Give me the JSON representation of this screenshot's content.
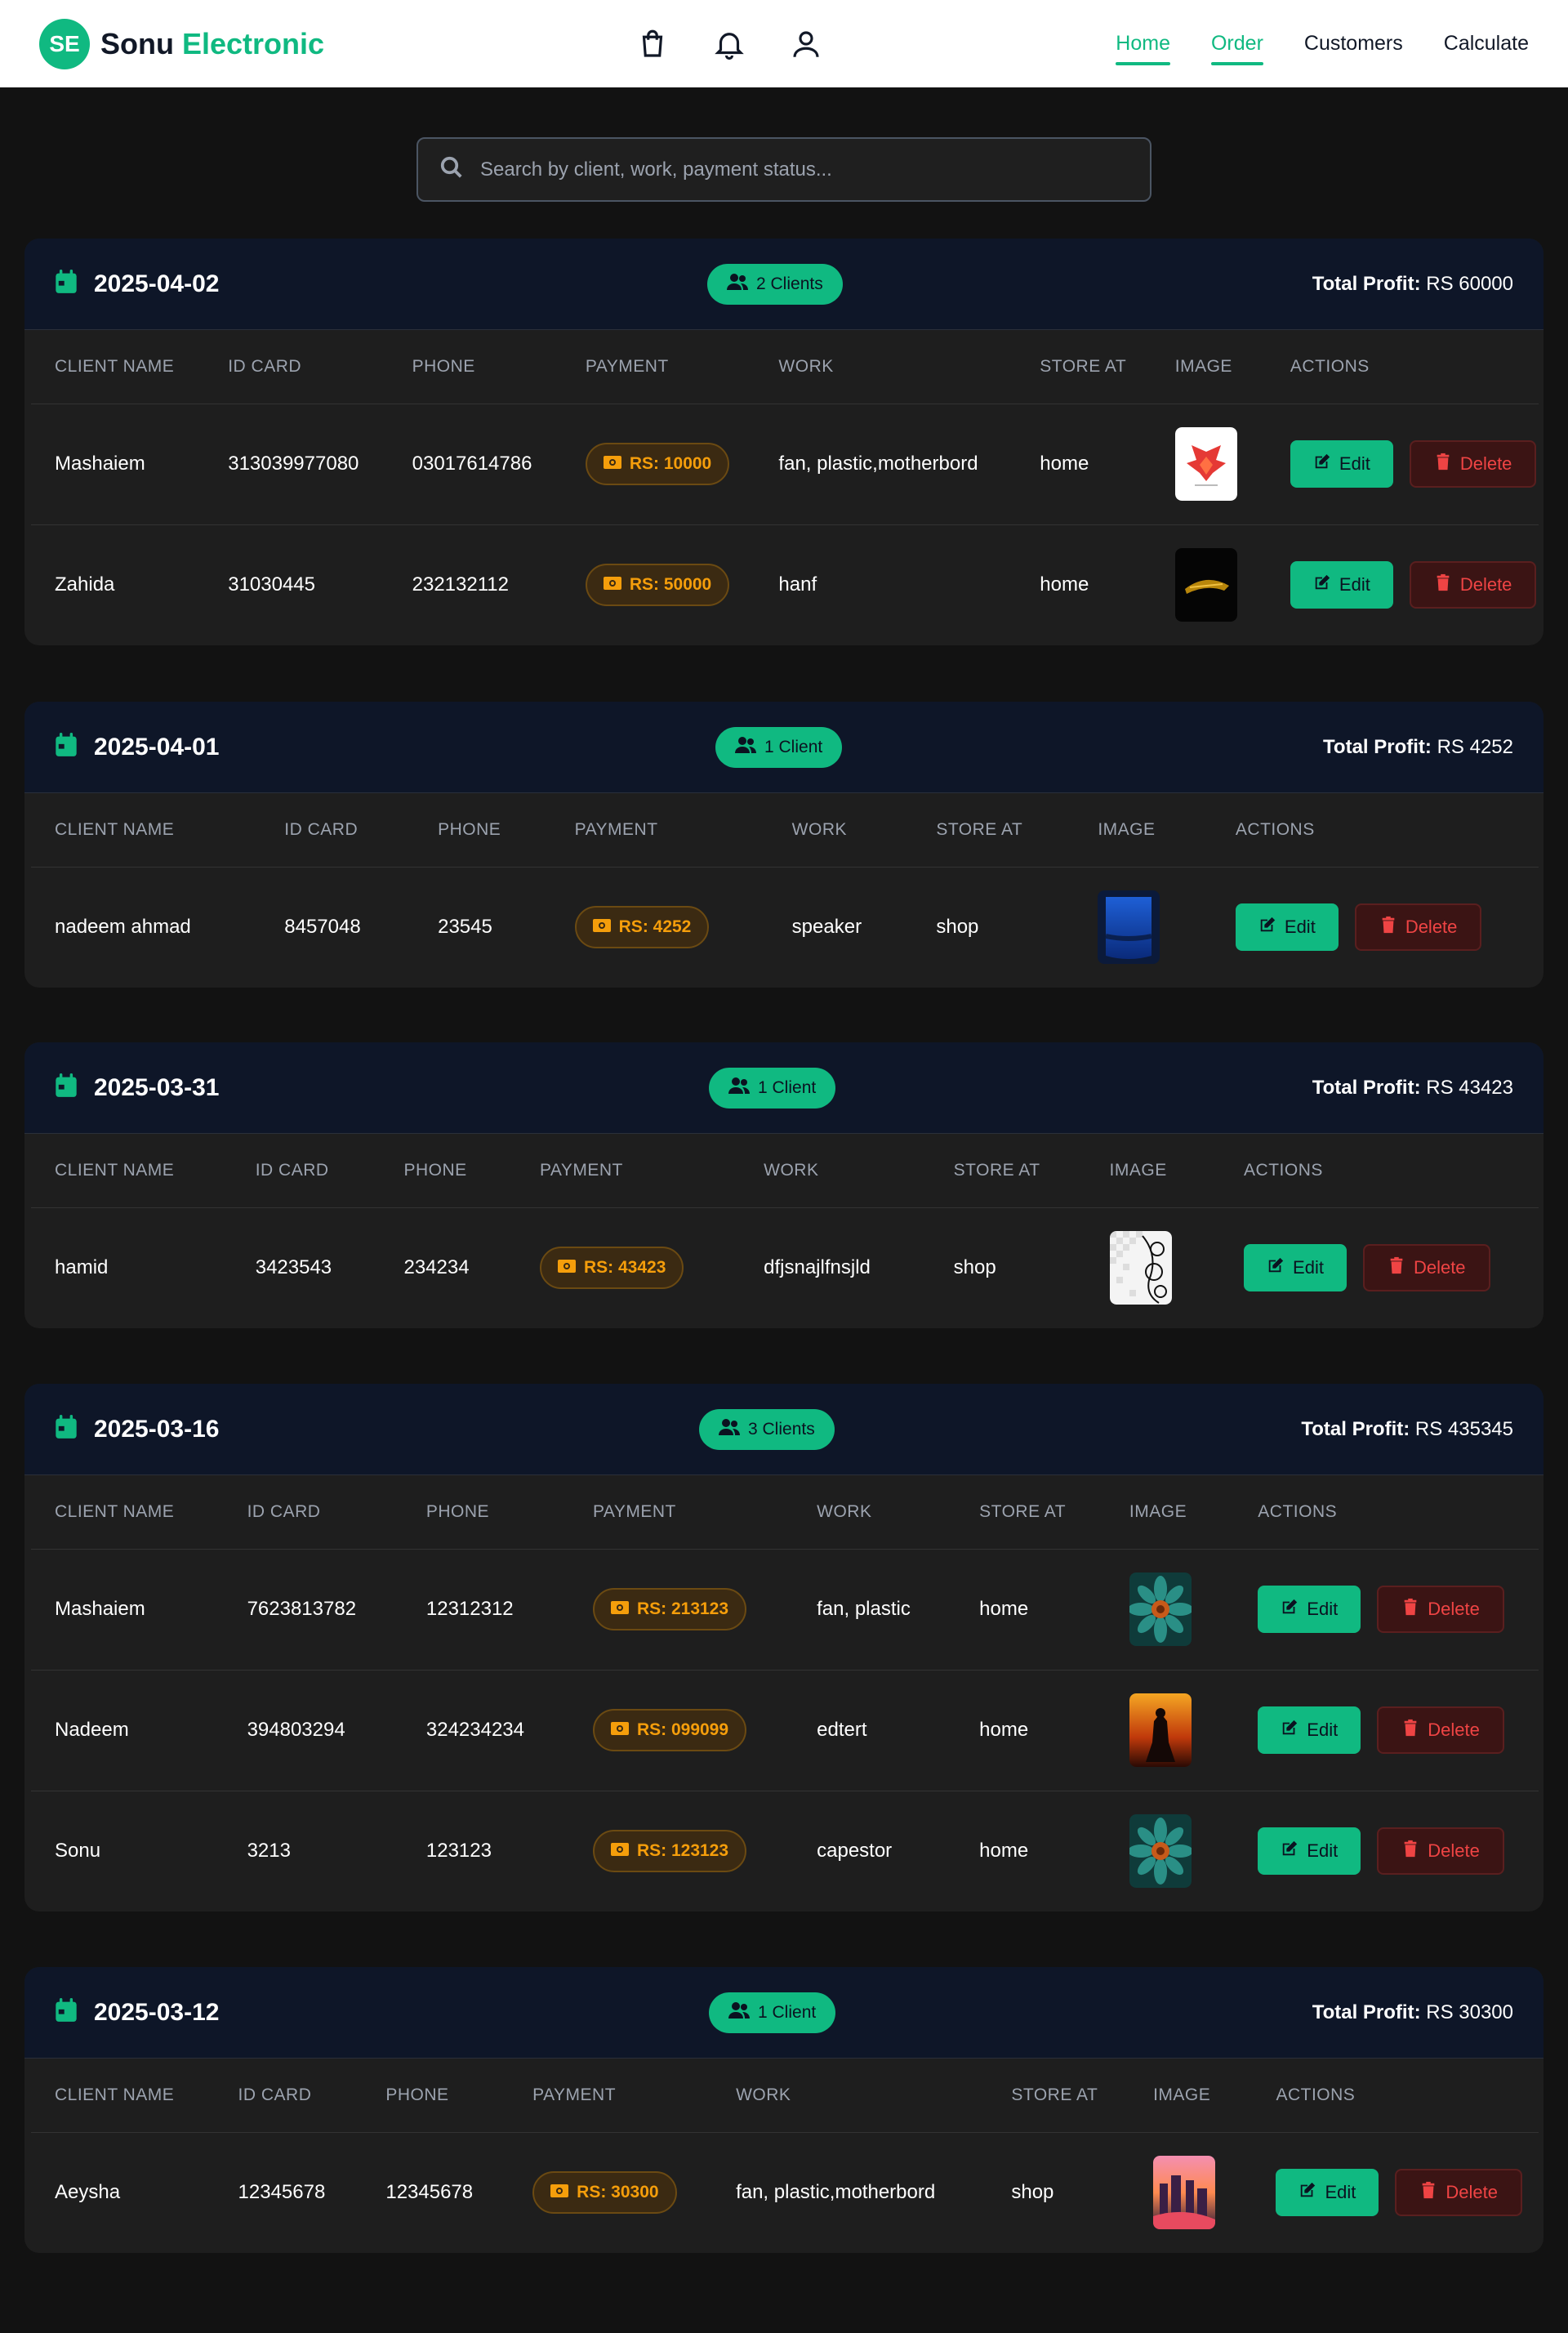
{
  "brand": {
    "logo": "SE",
    "name_part1": "Sonu",
    "name_part2": "Electronic"
  },
  "nav": {
    "icons": [
      "shopping-bag-icon",
      "bell-icon",
      "user-icon"
    ],
    "links": [
      {
        "label": "Home",
        "active": true
      },
      {
        "label": "Order",
        "active": true
      },
      {
        "label": "Customers",
        "active": false
      },
      {
        "label": "Calculate",
        "active": false
      }
    ]
  },
  "search": {
    "placeholder": "Search by client, work, payment status..."
  },
  "table_headers": [
    "CLIENT NAME",
    "ID CARD",
    "PHONE",
    "PAYMENT",
    "WORK",
    "STORE AT",
    "IMAGE",
    "ACTIONS"
  ],
  "actions": {
    "edit_label": "Edit",
    "delete_label": "Delete"
  },
  "labels": {
    "total_profit": "Total Profit:"
  },
  "groups": [
    {
      "date": "2025-04-02",
      "clients_label": "2 Clients",
      "profit": "RS 60000",
      "rows": [
        {
          "name": "Mashaiem",
          "id_card": "313039977080",
          "phone": "03017614786",
          "payment": "RS: 10000",
          "work": "fan, plastic,motherbord",
          "store": "home",
          "image": "phoenix-logo"
        },
        {
          "name": "Zahida",
          "id_card": "31030445",
          "phone": "232132112",
          "payment": "RS: 50000",
          "work": "hanf",
          "store": "home",
          "image": "dark-car"
        }
      ]
    },
    {
      "date": "2025-04-01",
      "clients_label": "1 Client",
      "profit": "RS 4252",
      "rows": [
        {
          "name": "nadeem ahmad",
          "id_card": "8457048",
          "phone": "23545",
          "payment": "RS: 4252",
          "work": "speaker",
          "store": "shop",
          "image": "blue-shirt"
        }
      ]
    },
    {
      "date": "2025-03-31",
      "clients_label": "1 Client",
      "profit": "RS 43423",
      "rows": [
        {
          "name": "hamid",
          "id_card": "3423543",
          "phone": "234234",
          "payment": "RS: 43423",
          "work": "dfjsnajlfnsjld",
          "store": "shop",
          "image": "floral-sketch"
        }
      ]
    },
    {
      "date": "2025-03-16",
      "clients_label": "3 Clients",
      "profit": "RS 435345",
      "rows": [
        {
          "name": "Mashaiem",
          "id_card": "7623813782",
          "phone": "12312312",
          "payment": "RS: 213123",
          "work": "fan, plastic",
          "store": "home",
          "image": "teal-flower"
        },
        {
          "name": "Nadeem",
          "id_card": "394803294",
          "phone": "324234234",
          "payment": "RS: 099099",
          "work": "edtert",
          "store": "home",
          "image": "fire-knight"
        },
        {
          "name": "Sonu",
          "id_card": "3213",
          "phone": "123123",
          "payment": "RS: 123123",
          "work": "capestor",
          "store": "home",
          "image": "teal-flower"
        }
      ]
    },
    {
      "date": "2025-03-12",
      "clients_label": "1 Client",
      "profit": "RS 30300",
      "rows": [
        {
          "name": "Aeysha",
          "id_card": "12345678",
          "phone": "12345678",
          "payment": "RS: 30300",
          "work": "fan, plastic,motherbord",
          "store": "shop",
          "image": "city-sunset"
        }
      ]
    }
  ],
  "colors": {
    "accent": "#10b981",
    "payment": "#f59e0b",
    "danger": "#ef4444",
    "header_bg": "#0e1628",
    "card_bg": "#1e1e1e",
    "page_bg": "#121212"
  }
}
